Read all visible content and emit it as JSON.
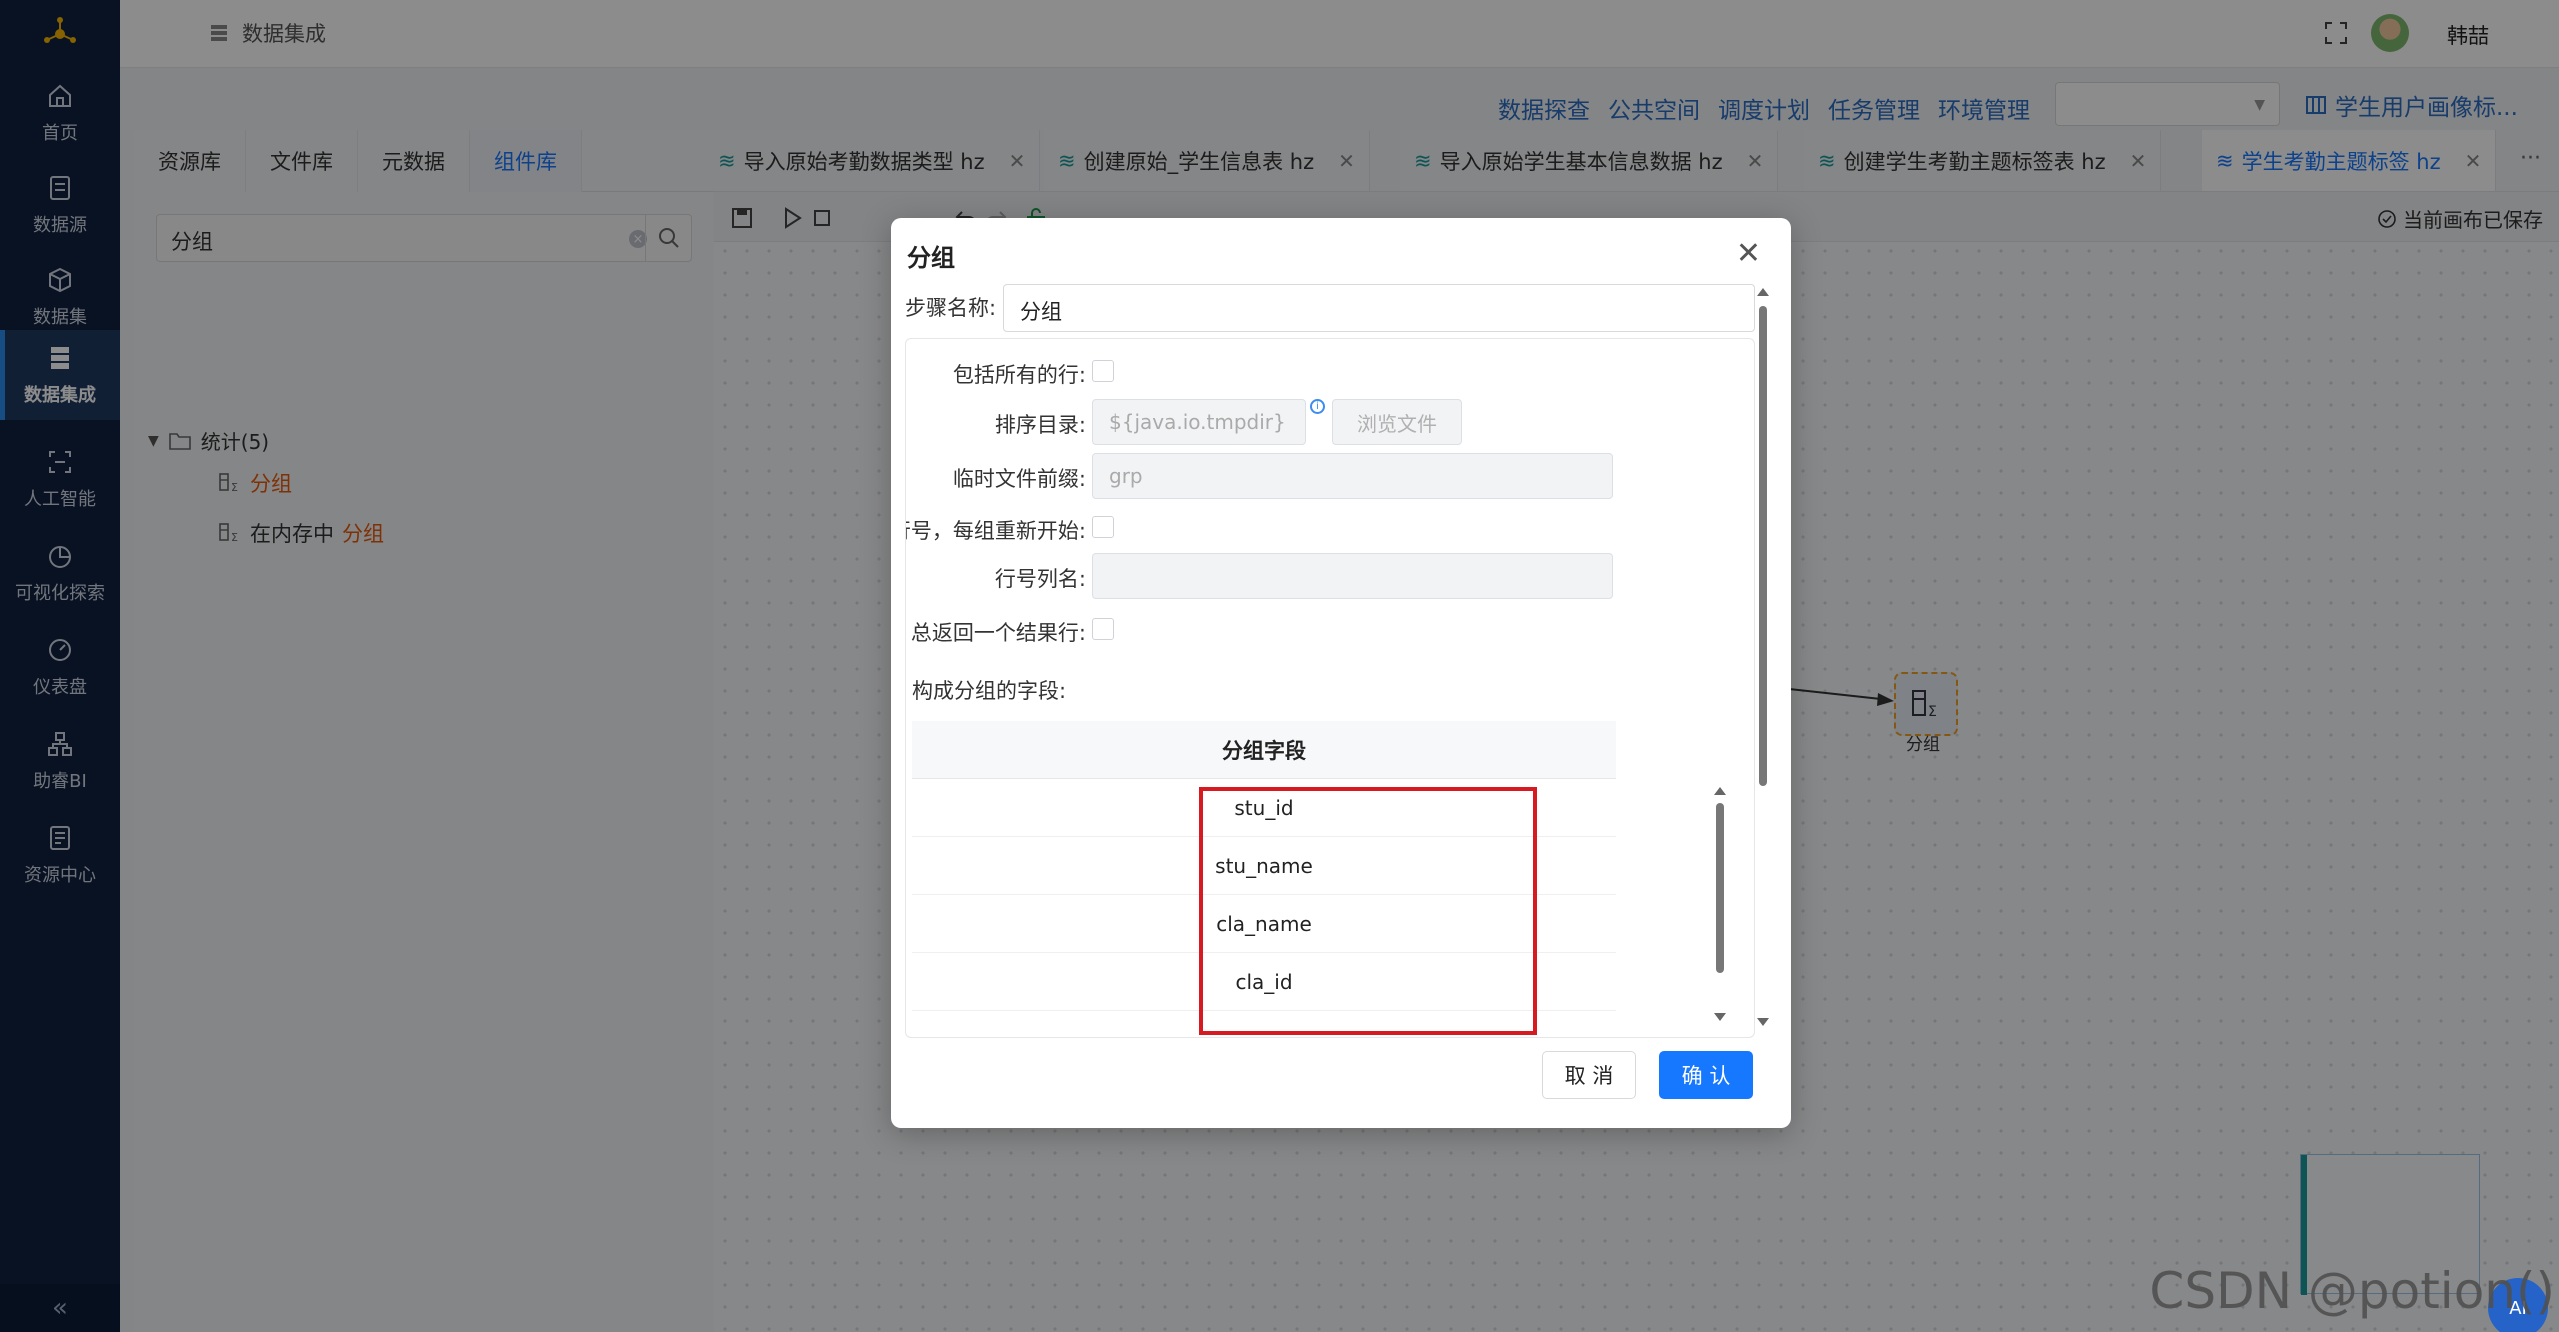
{
  "sidebar": {
    "items": [
      {
        "label": "首页",
        "icon": "home-icon"
      },
      {
        "label": "数据源",
        "icon": "database-icon"
      },
      {
        "label": "数据集",
        "icon": "cube-icon"
      },
      {
        "label": "数据集成",
        "icon": "server-icon",
        "active": true
      },
      {
        "label": "人工智能",
        "icon": "ai-icon"
      },
      {
        "label": "可视化探索",
        "icon": "pie-chart-icon"
      },
      {
        "label": "仪表盘",
        "icon": "dashboard-icon"
      },
      {
        "label": "助睿BI",
        "icon": "org-chart-icon"
      },
      {
        "label": "资源中心",
        "icon": "resource-icon"
      }
    ],
    "collapse": "«"
  },
  "header": {
    "breadcrumb": "数据集成",
    "username": "韩喆"
  },
  "submenu": [
    "数据探查",
    "公共空间",
    "调度计划",
    "任务管理",
    "环境管理"
  ],
  "project_title": "学生用户画像标...",
  "library": {
    "tabs": [
      "资源库",
      "文件库",
      "元数据",
      "组件库"
    ],
    "active_tab": 3,
    "search_value": "分组",
    "folder": "统计(5)",
    "items": [
      {
        "prefix": "",
        "highlight": "分组"
      },
      {
        "prefix": "在内存中 ",
        "highlight": "分组"
      }
    ]
  },
  "doc_tabs": [
    "导入原始考勤数据类型 hz",
    "创建原始_学生信息表 hz",
    "导入原始学生基本信息数据 hz",
    "创建学生考勤主题标签表 hz",
    "学生考勤主题标签 hz"
  ],
  "doc_tabs_more": "···",
  "canvas": {
    "saved_status": "当前画布已保存",
    "node_label": "分组"
  },
  "watermark": "CSDN @potion()",
  "help_bubble": "AI",
  "modal": {
    "title": "分组",
    "step_name_label": "步骤名称:",
    "step_name_value": "分组",
    "include_all_rows_label": "包括所有的行:",
    "sort_dir_label": "排序目录:",
    "sort_dir_placeholder": "${java.io.tmpdir}",
    "browse_label": "浏览文件",
    "temp_prefix_label": "临时文件前缀:",
    "temp_prefix_placeholder": "grp",
    "add_line_no_label": "增加行号，每组重新开始:",
    "line_no_col_label": "行号列名:",
    "always_one_row_label": "总返回一个结果行:",
    "group_fields_label": "构成分组的字段:",
    "table_header": "分组字段",
    "fields": [
      "stu_id",
      "stu_name",
      "cla_name",
      "cla_id"
    ],
    "cancel_label": "取 消",
    "ok_label": "确 认"
  }
}
